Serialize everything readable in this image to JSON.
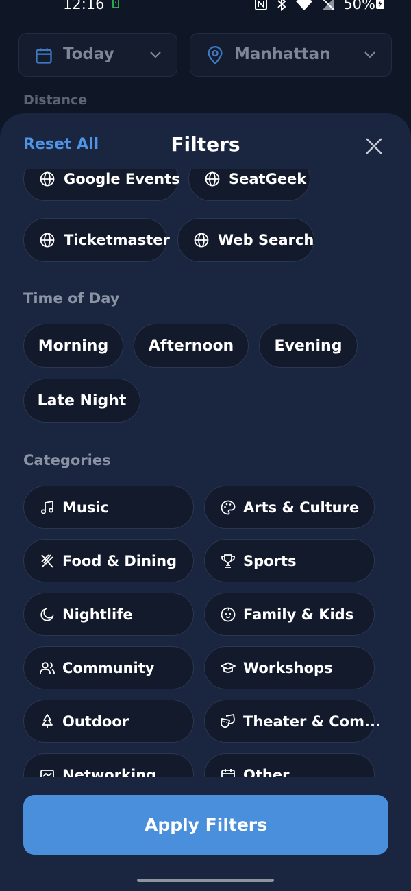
{
  "status_bar": {
    "time": "12:16",
    "battery": "50%"
  },
  "header": {
    "date_selector": {
      "label": "Today",
      "icon": "calendar-icon"
    },
    "location_selector": {
      "label": "Manhattan",
      "icon": "location-pin-icon"
    },
    "distance_label": "Distance"
  },
  "sheet": {
    "reset_label": "Reset All",
    "title": "Filters",
    "close_icon": "close-icon",
    "sources": [
      {
        "label": "Google Events",
        "icon": "globe-icon"
      },
      {
        "label": "SeatGeek",
        "icon": "globe-icon"
      },
      {
        "label": "Ticketmaster",
        "icon": "globe-icon"
      },
      {
        "label": "Web Search",
        "icon": "globe-icon"
      }
    ],
    "time_of_day": {
      "label": "Time of Day",
      "options": [
        "Morning",
        "Afternoon",
        "Evening",
        "Late Night"
      ]
    },
    "categories": {
      "label": "Categories",
      "items": [
        {
          "label": "Music",
          "icon": "music-note-icon"
        },
        {
          "label": "Arts & Culture",
          "icon": "palette-icon"
        },
        {
          "label": "Food & Dining",
          "icon": "utensils-icon"
        },
        {
          "label": "Sports",
          "icon": "trophy-icon"
        },
        {
          "label": "Nightlife",
          "icon": "moon-icon"
        },
        {
          "label": "Family & Kids",
          "icon": "baby-face-icon"
        },
        {
          "label": "Community",
          "icon": "users-icon"
        },
        {
          "label": "Workshops",
          "icon": "graduation-cap-icon"
        },
        {
          "label": "Outdoor",
          "icon": "tree-icon"
        },
        {
          "label": "Theater & Com...",
          "icon": "theater-masks-icon"
        },
        {
          "label": "Networking",
          "icon": "networking-icon"
        },
        {
          "label": "Other",
          "icon": "calendar-icon"
        }
      ]
    },
    "apply_label": "Apply Filters"
  },
  "colors": {
    "background": "#0f1626",
    "sheet": "#1a2540",
    "pill": "#131a2c",
    "accent": "#4a8fdb",
    "link": "#4f95e5",
    "muted_text": "#8a93a3"
  }
}
